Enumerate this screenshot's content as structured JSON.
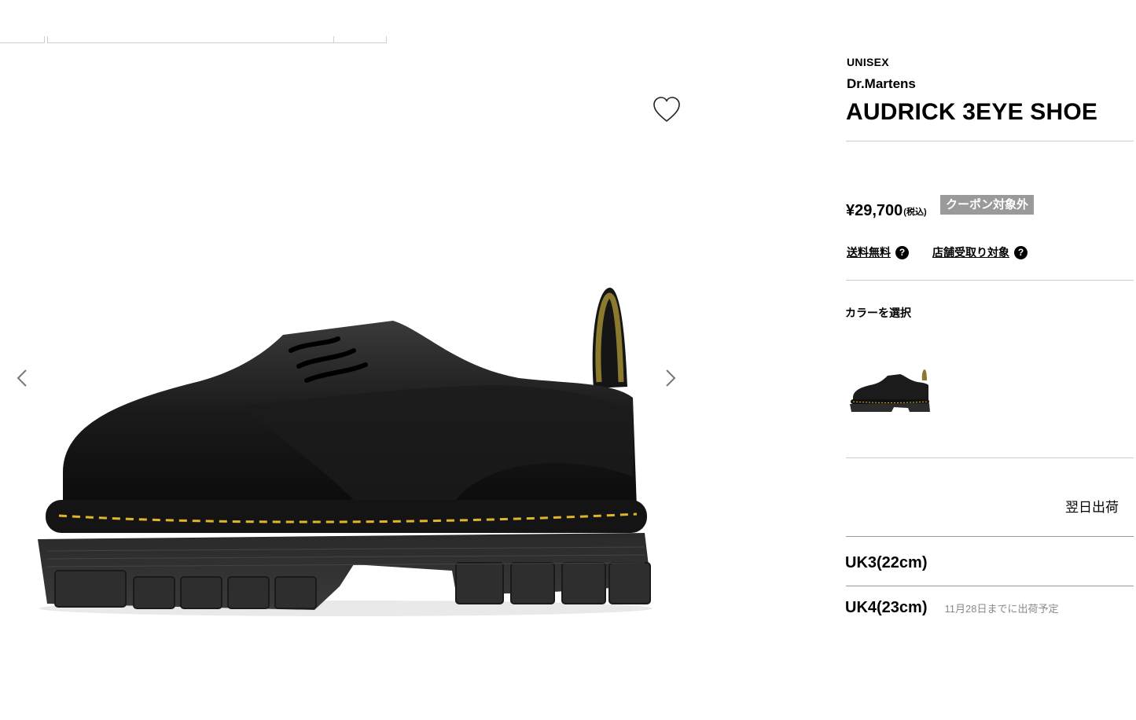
{
  "product": {
    "gender": "UNISEX",
    "brand": "Dr.Martens",
    "name": "AUDRICK 3EYE SHOE",
    "price": "¥29,700",
    "tax_note": "(税込)",
    "coupon_badge": "クーポン対象外"
  },
  "services": [
    {
      "label": "送料無料",
      "help_icon": "question-icon"
    },
    {
      "label": "店舗受取り対象",
      "help_icon": "question-icon"
    }
  ],
  "color_section": {
    "label": "カラーを選択"
  },
  "shipping": {
    "status": "翌日出荷"
  },
  "sizes": [
    {
      "label": "UK3(22cm)",
      "note": ""
    },
    {
      "label": "UK4(23cm)",
      "note": "11月28日までに出荷予定"
    }
  ],
  "icons": {
    "favorite": "heart-outline-icon",
    "prev": "chevron-left-icon",
    "next": "chevron-right-icon"
  },
  "colors": {
    "coupon_bg": "#9a9a9a",
    "divider": "#cccccc",
    "stitch": "#e0b52a"
  }
}
